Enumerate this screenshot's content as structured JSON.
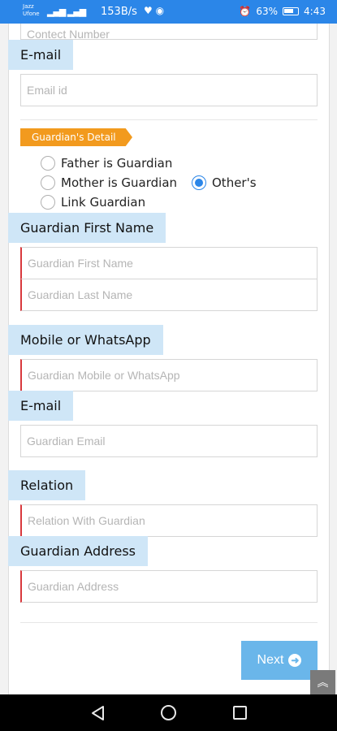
{
  "status_bar": {
    "carrier_top": "Jazz",
    "carrier_bottom": "Ufone",
    "net_speed": "153B/s",
    "battery": "63%",
    "time": "4:43"
  },
  "form": {
    "contact_placeholder": "Contect Number",
    "email_label": "E-mail",
    "email_placeholder": "Email id",
    "guardian_section_title": "Guardian's Detail",
    "guardian_options": [
      {
        "label": "Father is Guardian",
        "checked": false
      },
      {
        "label": "Mother is Guardian",
        "checked": false
      },
      {
        "label": "Other's",
        "checked": true
      },
      {
        "label": "Link Guardian",
        "checked": false
      }
    ],
    "guardian_first_name_label": "Guardian First Name",
    "guardian_first_name_placeholder": "Guardian First Name",
    "guardian_last_name_placeholder": "Guardian Last Name",
    "mobile_label": "Mobile or WhatsApp",
    "mobile_placeholder": "Guardian Mobile or WhatsApp",
    "guardian_email_label": "E-mail",
    "guardian_email_placeholder": "Guardian Email",
    "relation_label": "Relation",
    "relation_placeholder": "Relation With Guardian",
    "address_label": "Guardian Address",
    "address_placeholder": "Guardian Address",
    "next_label": "Next"
  },
  "colors": {
    "status_bar": "#2b86e8",
    "label_bg": "#cfe6f7",
    "section_tag": "#f29a1e",
    "required_marker": "#d9393d",
    "next_button": "#6ab6ea"
  }
}
